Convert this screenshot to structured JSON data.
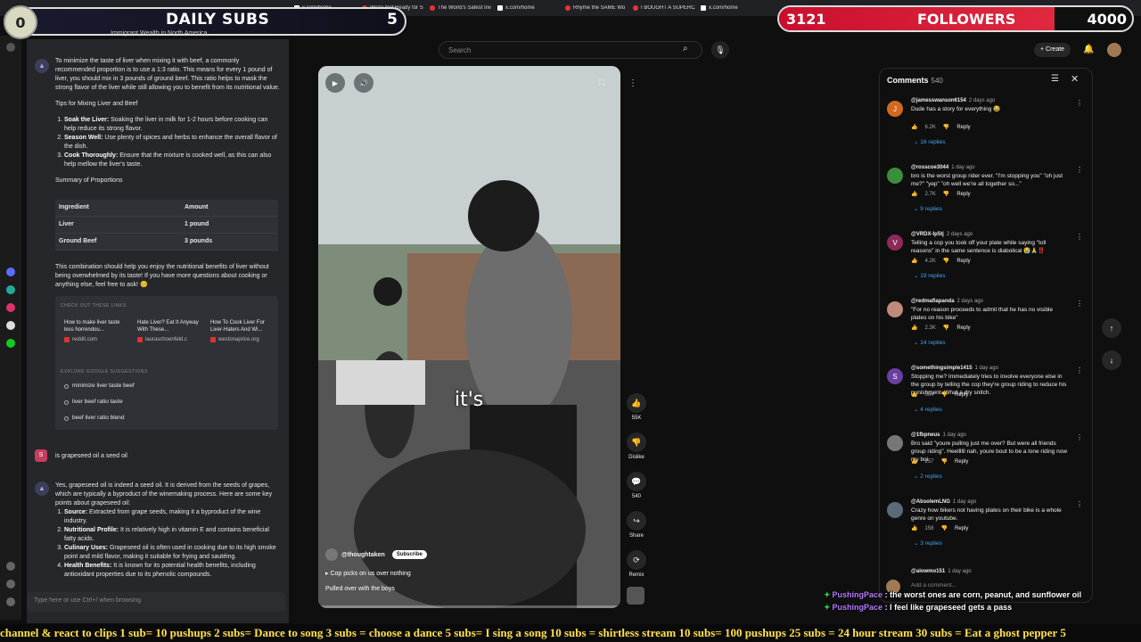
{
  "browser_tabs": [
    {
      "label": "x.com/home",
      "icon": "x-icon"
    },
    {
      "label": "We're Not Ready for S",
      "icon": "youtube-icon"
    },
    {
      "label": "The World's Safest Inv",
      "icon": "youtube-icon"
    },
    {
      "label": "x.com/home",
      "icon": "x-icon"
    },
    {
      "label": "Rhyme the SAME Wo",
      "icon": "youtube-icon"
    },
    {
      "label": "I BOUGHT A SUPERCA",
      "icon": "youtube-icon"
    },
    {
      "label": "x.com/home",
      "icon": "x-icon"
    }
  ],
  "overlay_subs": {
    "left_number": "0",
    "label": "DAILY SUBS",
    "count": "5",
    "subtitle": "Immigrant Wealth in North America"
  },
  "overlay_followers": {
    "current": "3121",
    "label": "FOLLOWERS",
    "goal": "4000",
    "progress_fraction": 0.78
  },
  "chat": {
    "intro": {
      "p1": "To minimize the taste of liver when mixing it with beef, a commonly recommended proportion is to use a 1:3 ratio. This means for every 1 pound of liver, you should mix in 3 pounds of ground beef. This ratio helps to mask the strong flavor of the liver while still allowing you to benefit from its nutritional value.",
      "tips_title": "Tips for Mixing Liver and Beef",
      "tips": [
        {
          "head": "Soak the Liver:",
          "body": "Soaking the liver in milk for 1-2 hours before cooking can help reduce its strong flavor."
        },
        {
          "head": "Season Well:",
          "body": "Use plenty of spices and herbs to enhance the overall flavor of the dish."
        },
        {
          "head": "Cook Thoroughly:",
          "body": "Ensure that the mixture is cooked well, as this can also help mellow the liver's taste."
        }
      ],
      "summary_title": "Summary of Proportions"
    },
    "table": {
      "headers": [
        "Ingredient",
        "Amount"
      ],
      "rows": [
        [
          "Liver",
          "1 pound"
        ],
        [
          "Ground Beef",
          "3 pounds"
        ]
      ]
    },
    "closing": "This combination should help you enjoy the nutritional benefits of liver without being overwhelmed by its taste! If you have more questions about cooking or anything else, feel free to ask! 😊",
    "links_heading": "CHECK OUT THESE LINKS",
    "links": [
      {
        "title": "How to make liver taste less horrendou...",
        "source": "reddit.com"
      },
      {
        "title": "Hate Liver? Eat It Anyway With These...",
        "source": "lauraschoenfeld.c"
      },
      {
        "title": "How To Cook Liver For Liver-Haters And Wi...",
        "source": "westonaprice.org"
      }
    ],
    "sugg_heading": "EXPLORE GOOGLE SUGGESTIONS",
    "suggestions": [
      "minimize liver taste beef",
      "liver beef ratio taste",
      "beef liver ratio blend"
    ],
    "user_avatar": "S",
    "user_msg": "is grapeseed oil a seed oil",
    "answer_intro": "Yes, grapeseed oil is indeed a seed oil. It is derived from the seeds of grapes, which are typically a byproduct of the winemaking process. Here are some key points about grapeseed oil:",
    "points": [
      {
        "head": "Source:",
        "body": "Extracted from grape seeds, making it a byproduct of the wine industry."
      },
      {
        "head": "Nutritional Profile:",
        "body": "It is relatively high in vitamin E and contains beneficial fatty acids."
      },
      {
        "head": "Culinary Uses:",
        "body": "Grapeseed oil is often used in cooking due to its high smoke point and mild flavor, making it suitable for frying and sautéing."
      },
      {
        "head": "Health Benefits:",
        "body": "It is known for its potential health benefits, including antioxidant properties due to its phenolic compounds."
      }
    ],
    "input_placeholder": "Type here or use Ctrl+/ when browsing"
  },
  "youtube": {
    "search_placeholder": "Search",
    "create_label": "Create",
    "video": {
      "caption": "it's",
      "channel": "@thoughtaken",
      "subscribe_label": "Subscribe",
      "line1": "Cop picks on us over nothing",
      "line2": "Pulled over with the boys"
    },
    "actions": [
      {
        "icon": "like-icon",
        "label": "55K"
      },
      {
        "icon": "dislike-icon",
        "label": "Dislike"
      },
      {
        "icon": "comment-icon",
        "label": "540"
      },
      {
        "icon": "share-icon",
        "label": "Share"
      },
      {
        "icon": "remix-icon",
        "label": "Remix"
      }
    ],
    "comments": {
      "title": "Comments",
      "count": "540",
      "items": [
        {
          "avatar": "J",
          "color": "#d2691e",
          "user": "@jamesswanson6154",
          "time": "2 days ago",
          "text": "Dude has a story for everything 😂",
          "likes": "6.2K",
          "reply": "Reply",
          "replies": "16 replies"
        },
        {
          "avatar": "",
          "color": "#3a8f3a",
          "user": "@rosscoe3044",
          "time": "1 day ago",
          "text": "bro is the worst group rider ever. \"I'm stopping you\" \"oh just me?\" \"yep\" \"oh well we're all together so...\"",
          "likes": "2.7K",
          "reply": "Reply",
          "replies": "9 replies"
        },
        {
          "avatar": "V",
          "color": "#8e2a5a",
          "user": "@VRDX-lp5tj",
          "time": "2 days ago",
          "text": "Telling a cop you took off your plate while saying \"toll reasons\" in the same sentence is diabolical 😭🙏‼️",
          "likes": "4.2K",
          "reply": "Reply",
          "replies": "19 replies"
        },
        {
          "avatar": "",
          "color": "#c08a7a",
          "user": "@redmafiapanda",
          "time": "2 days ago",
          "text": "\"For no reason proceeds to admit that he has no visible plates on his bike\"",
          "likes": "2.3K",
          "reply": "Reply",
          "replies": "14 replies"
        },
        {
          "avatar": "S",
          "color": "#6a3fa0",
          "user": "@somethingsimple1415",
          "time": "1 day ago",
          "text": "Stopping me? Immediately tries to involve everyone else in the group by telling the cop they're group riding to reduce his punishment. What a dry snitch.",
          "likes": "664",
          "reply": "Reply",
          "replies": "4 replies"
        },
        {
          "avatar": "",
          "color": "#777777",
          "user": "@1fbpneus",
          "time": "1 day ago",
          "text": "Bro said \"youre pulling just me over? But were all friends group riding\". Heellllll nah, youre bout to be a lone riding now my boi",
          "likes": "257",
          "reply": "Reply",
          "replies": "2 replies"
        },
        {
          "avatar": "",
          "color": "#5a6a7a",
          "user": "@AbsolemLNG",
          "time": "1 day ago",
          "text": "Crazy how bikers not having plates on their bike is a whole genre on youtube.",
          "likes": "158",
          "reply": "Reply",
          "replies": "3 replies"
        }
      ],
      "partial_user": "@alowmo151",
      "partial_time": "1 day ago",
      "add_placeholder": "Add a comment..."
    }
  },
  "stream_chat": [
    {
      "user": "PushingPace",
      "text": "the worst ones are corn, peanut, and sunflower oil"
    },
    {
      "user": "PushingPace",
      "text": "I feel like grapeseed gets a pass"
    }
  ],
  "ticker": "channel & react to clips  1 sub= 10 pushups  2 subs= Dance to song  3 subs = choose a dance  5 subs= I sing a song  10 subs = shirtless stream 10 subs= 100 pushups  25 subs = 24 hour stream  30 subs = Eat a ghost pepper 5"
}
